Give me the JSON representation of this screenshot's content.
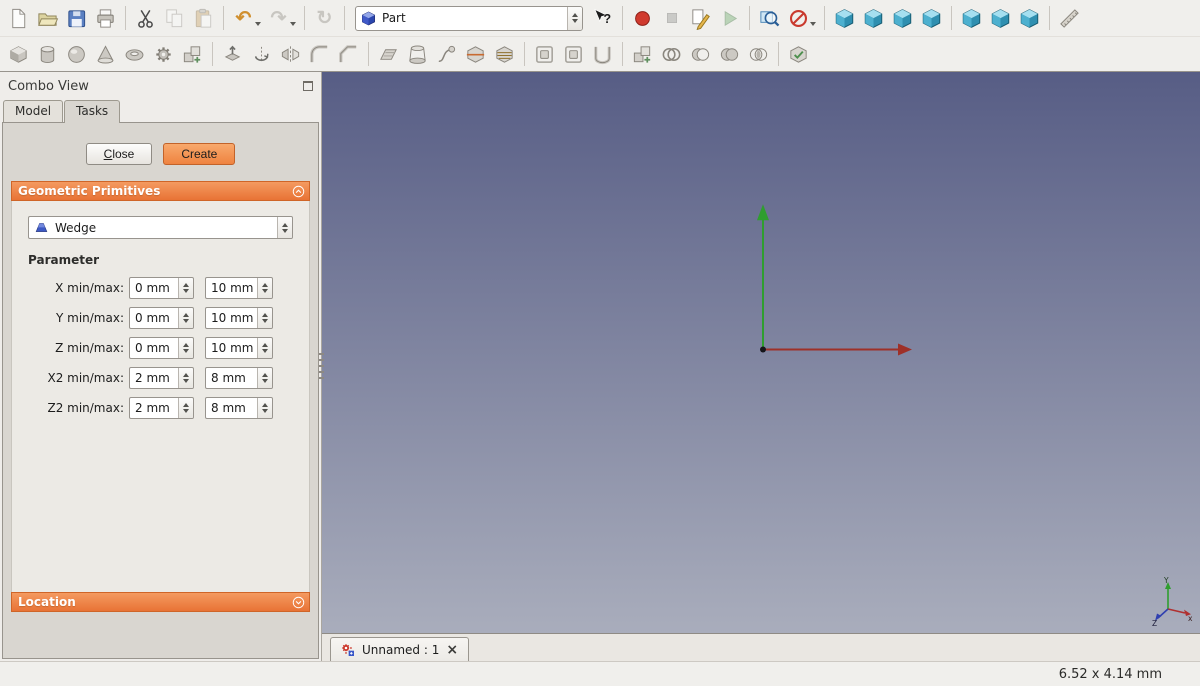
{
  "toolbar_top": {
    "workbench_selector": {
      "value": "Part"
    },
    "glyphs": {
      "undo": "↶",
      "redo": "↷",
      "refresh": "↻"
    },
    "row1_groups": [
      [
        "new-document",
        "open-document",
        "save-document",
        "print-document"
      ],
      [
        "cut",
        "copy",
        "paste"
      ],
      [
        "undo",
        "redo"
      ],
      [
        "refresh"
      ],
      [
        "workbench-selector",
        "whats-this"
      ],
      [
        "macro-record",
        "macro-stop",
        "macro-edit",
        "macro-execute"
      ],
      [
        "fit-all",
        "draw-style"
      ],
      [
        "view-axonometric",
        "view-front",
        "view-top",
        "view-right"
      ],
      [
        "view-rear",
        "view-bottom",
        "view-left"
      ],
      [
        "measure-distance"
      ]
    ],
    "row2_groups": [
      [
        "box",
        "cylinder",
        "sphere",
        "cone",
        "torus",
        "create-primitives",
        "shape-builder"
      ],
      [
        "extrude",
        "revolve",
        "mirror",
        "fillet",
        "chamfer"
      ],
      [
        "ruled-surface",
        "loft",
        "sweep",
        "section",
        "cross-sections"
      ],
      [
        "offset-3d",
        "offset-2d",
        "thickness"
      ],
      [
        "compound",
        "boolean",
        "cut",
        "union",
        "intersection"
      ],
      [
        "check-geometry"
      ]
    ],
    "disabled_buttons": [
      "copy",
      "paste",
      "redo",
      "refresh",
      "macro-stop",
      "macro-execute"
    ]
  },
  "combo_view": {
    "title": "Combo View",
    "tabs": [
      {
        "label": "Model",
        "active": false
      },
      {
        "label": "Tasks",
        "active": true
      }
    ],
    "task_buttons": {
      "close_accel": "C",
      "close_rest": "lose",
      "create": "Create"
    },
    "primitives_section": {
      "title": "Geometric Primitives",
      "shape_selector": {
        "value": "Wedge"
      },
      "parameter_heading": "Parameter",
      "parameters": [
        {
          "label": "X min/max:",
          "min": "0 mm",
          "max": "10 mm"
        },
        {
          "label": "Y min/max:",
          "min": "0 mm",
          "max": "10 mm"
        },
        {
          "label": "Z min/max:",
          "min": "0 mm",
          "max": "10 mm"
        },
        {
          "label": "X2 min/max:",
          "min": "2 mm",
          "max": "8 mm"
        },
        {
          "label": "Z2 min/max:",
          "min": "2 mm",
          "max": "8 mm"
        }
      ]
    },
    "location_section": {
      "title": "Location"
    }
  },
  "viewport": {
    "axes": [
      {
        "name": "x",
        "color": "#9e3028",
        "direction": "right"
      },
      {
        "name": "y",
        "color": "#2f9e2f",
        "direction": "up"
      }
    ],
    "nav_cluster": {
      "x_label": "x",
      "y_label": "Y",
      "z_label": "Z"
    },
    "background_top": "#575d85",
    "background_bottom": "#a9adbc"
  },
  "document_tabs": [
    {
      "label": "Unnamed : 1",
      "active": true,
      "close_glyph": "×"
    }
  ],
  "status_bar": {
    "dimensions": "6.52 x 4.14 mm"
  },
  "colors": {
    "accent_orange": "#e87335",
    "header_gradient_top": "#f49a60",
    "create_button": "#ef8340"
  }
}
